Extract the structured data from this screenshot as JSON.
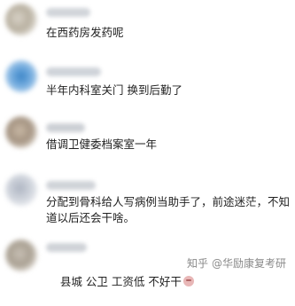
{
  "comments": [
    {
      "text": "在西药房发药呢"
    },
    {
      "text": "半年内科室关门 换到后勤了"
    },
    {
      "text": "借调卫健委档案室一年"
    },
    {
      "text": "分配到骨科给人写病例当助手了，前途迷茫，不知道以后还会干啥。"
    },
    {
      "text": "县城 公卫 工资低 不好干",
      "emoji": "crying-face-emoji"
    }
  ],
  "watermark": {
    "site": "知乎",
    "handle": "@华励康复考研"
  },
  "colors": {
    "text": "#222222",
    "watermark": "#8a8a8a"
  }
}
